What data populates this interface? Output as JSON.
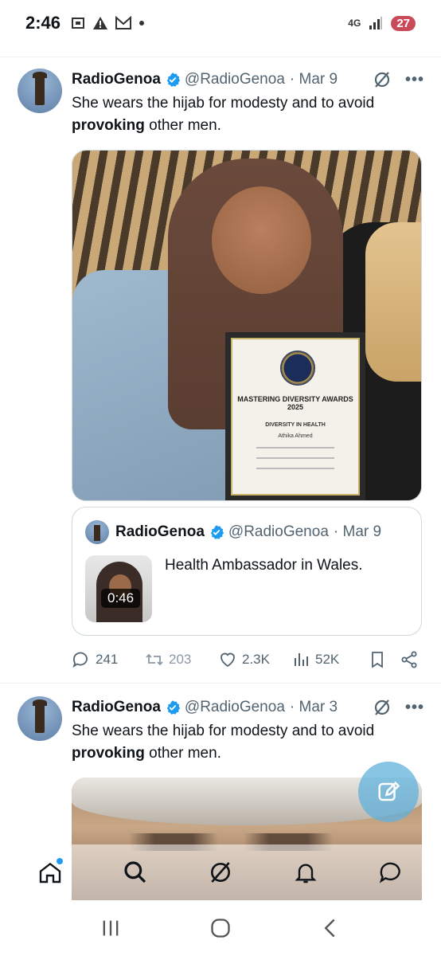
{
  "status_bar": {
    "time": "2:46",
    "network": "4G",
    "battery": "27"
  },
  "tweets": [
    {
      "name": "RadioGenoa",
      "handle": "@RadioGenoa",
      "date": "· Mar 9",
      "text_before": "She wears the hijab for modesty and to avoid ",
      "text_bold": "provoking",
      "text_after": " other men.",
      "image": {
        "certificate_title": "MASTERING DIVERSITY AWARDS 2025",
        "certificate_subtitle": "DIVERSITY IN HEALTH",
        "certificate_name": "Athika Ahmed"
      },
      "quote": {
        "name": "RadioGenoa",
        "handle": "@RadioGenoa",
        "date": "· Mar 9",
        "text": "Health Ambassador in Wales.",
        "video_duration": "0:46"
      },
      "actions": {
        "replies": "241",
        "retweets": "203",
        "likes": "2.3K",
        "views": "52K"
      }
    },
    {
      "name": "RadioGenoa",
      "handle": "@RadioGenoa",
      "date": "· Mar 3",
      "text_before": "She wears the hijab for modesty and to avoid ",
      "text_bold": "provoking",
      "text_after": " other men."
    }
  ],
  "icons": {
    "verified": "verified-badge-icon",
    "grok": "grok-icon",
    "more": "more-options-icon",
    "compose": "compose-icon",
    "nav": [
      "home-icon",
      "search-icon",
      "grok-icon",
      "notifications-icon",
      "messages-icon"
    ],
    "android": [
      "recents-icon",
      "home-circle-icon",
      "back-icon"
    ]
  },
  "colors": {
    "accent": "#1d9bf0",
    "text": "#0f1419",
    "muted": "#536471",
    "battery": "#c94b5a"
  }
}
